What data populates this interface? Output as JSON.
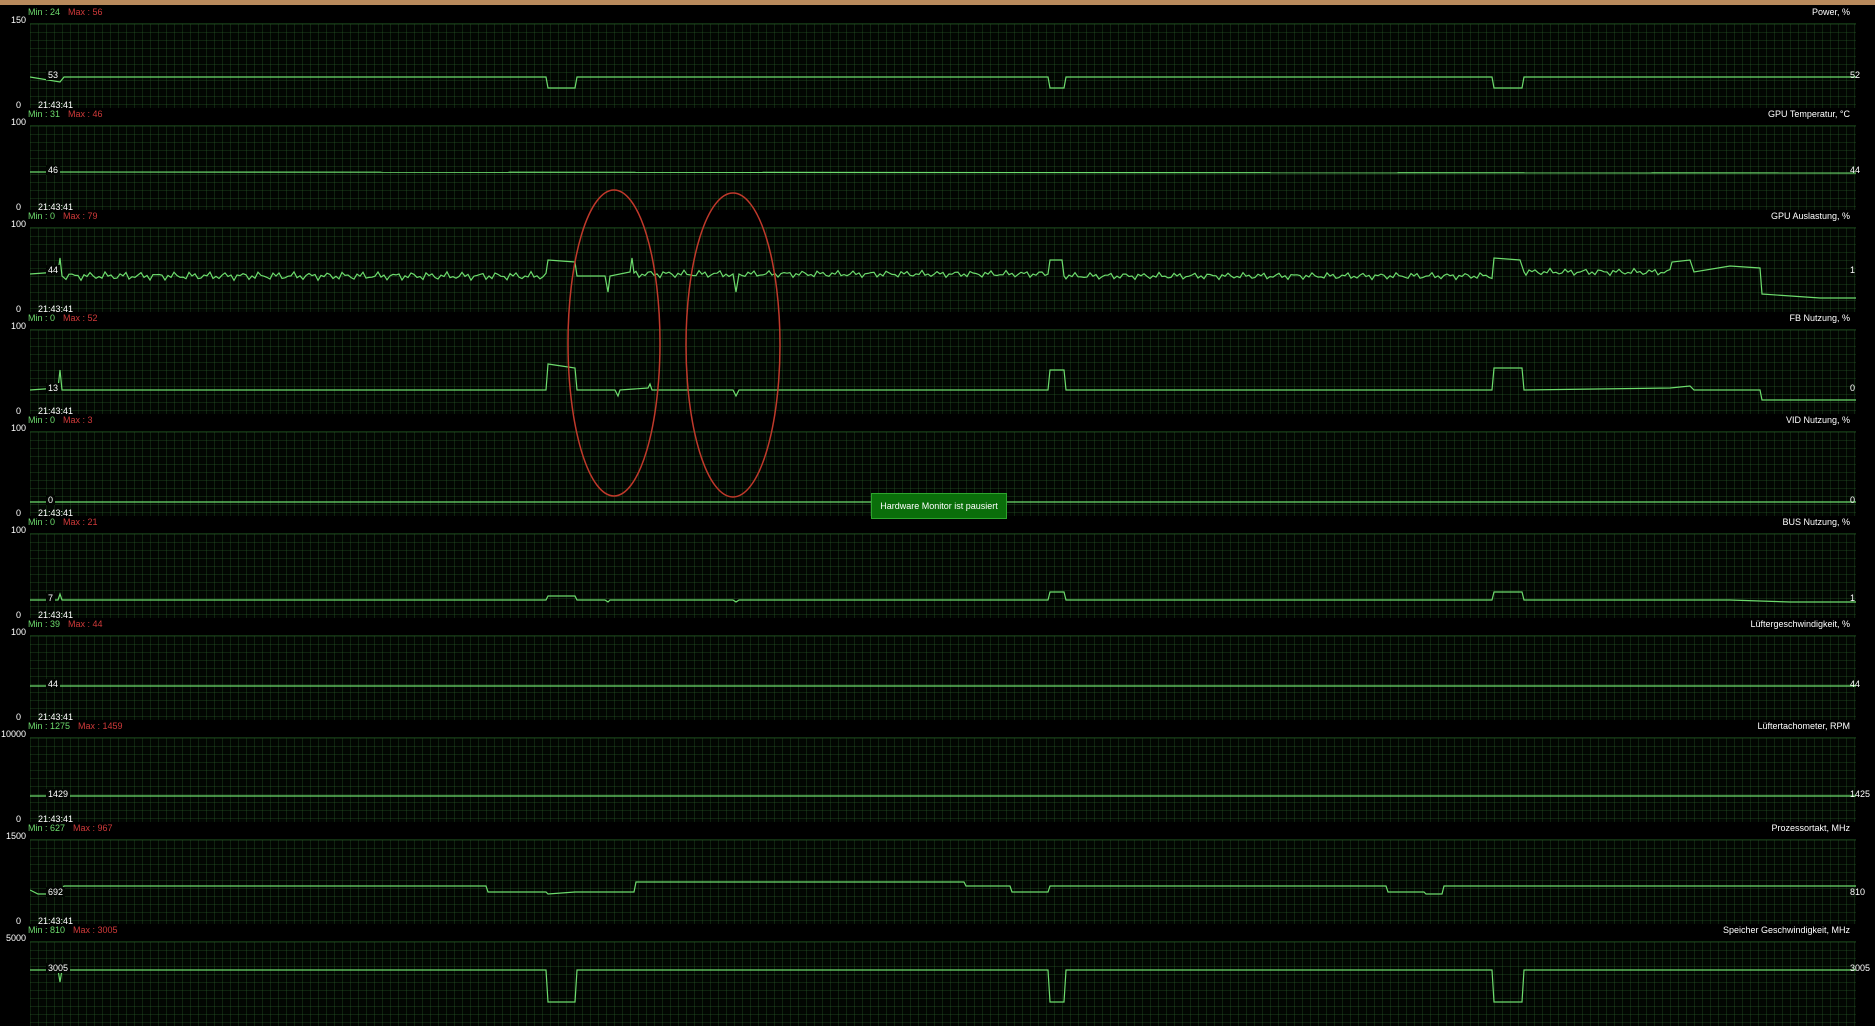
{
  "paused_label": "Hardware Monitor ist pausiert",
  "accent_color": "#6ddc6d",
  "max_color": "#d03a3a",
  "panels": [
    {
      "title": "Power, %",
      "min_label": "Min : 24",
      "max_label": "Max : 56",
      "ymax": "150",
      "ymin": "0",
      "time": "21:43:41",
      "left_value": "53",
      "right_value": "52"
    },
    {
      "title": "GPU Temperatur, °C",
      "min_label": "Min : 31",
      "max_label": "Max : 46",
      "ymax": "100",
      "ymin": "0",
      "time": "21:43:41",
      "left_value": "46",
      "right_value": "44"
    },
    {
      "title": "GPU Auslastung, %",
      "min_label": "Min : 0",
      "max_label": "Max : 79",
      "ymax": "100",
      "ymin": "0",
      "time": "21:43:41",
      "left_value": "44",
      "right_value": "1"
    },
    {
      "title": "FB Nutzung, %",
      "min_label": "Min : 0",
      "max_label": "Max : 52",
      "ymax": "100",
      "ymin": "0",
      "time": "21:43:41",
      "left_value": "13",
      "right_value": "0"
    },
    {
      "title": "VID Nutzung, %",
      "min_label": "Min : 0",
      "max_label": "Max : 3",
      "ymax": "100",
      "ymin": "0",
      "time": "21:43:41",
      "left_value": "0",
      "right_value": "0"
    },
    {
      "title": "BUS Nutzung, %",
      "min_label": "Min : 0",
      "max_label": "Max : 21",
      "ymax": "100",
      "ymin": "0",
      "time": "21:43:41",
      "left_value": "7",
      "right_value": "1"
    },
    {
      "title": "Lüftergeschwindigkeit, %",
      "min_label": "Min : 39",
      "max_label": "Max : 44",
      "ymax": "100",
      "ymin": "0",
      "time": "21:43:41",
      "left_value": "44",
      "right_value": "44"
    },
    {
      "title": "Lüftertachometer, RPM",
      "min_label": "Min : 1275",
      "max_label": "Max : 1459",
      "ymax": "10000",
      "ymin": "0",
      "time": "21:43:41",
      "left_value": "1429",
      "right_value": "1425"
    },
    {
      "title": "Prozessortakt, MHz",
      "min_label": "Min : 627",
      "max_label": "Max : 967",
      "ymax": "1500",
      "ymin": "0",
      "time": "21:43:41",
      "left_value": "692",
      "right_value": "810"
    },
    {
      "title": "Speicher Geschwindigkeit, MHz",
      "min_label": "Min : 810",
      "max_label": "Max : 3005",
      "ymax": "5000",
      "ymin": "",
      "time": "",
      "left_value": "3005",
      "right_value": "3005"
    }
  ]
}
